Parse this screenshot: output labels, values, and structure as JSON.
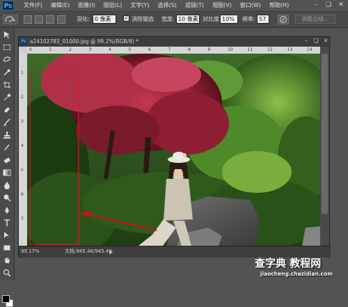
{
  "menubar": {
    "logo": "Ps",
    "items": [
      "文件(F)",
      "编辑(E)",
      "图像(I)",
      "图层(L)",
      "文字(Y)",
      "选择(S)",
      "滤镜(T)",
      "视图(V)",
      "窗口(W)",
      "帮助(H)"
    ]
  },
  "options": {
    "feather_label": "羽化:",
    "feather_value": "0 像素",
    "antialias_label": "消除锯齿",
    "width_label": "宽度:",
    "width_value": "10 像素",
    "contrast_label": "对比度:",
    "contrast_value": "10%",
    "frequency_label": "频率:",
    "frequency_value": "57",
    "refine_edge_label": "调整边缘..."
  },
  "document": {
    "title": "a24102783_01000.jpg @ 99.2%(RGB/8) *",
    "zoom": "99.17%",
    "doc_info": "文档:945.4K/945.4K",
    "ruler_top": [
      "0",
      "1",
      "2",
      "3",
      "4",
      "5",
      "6",
      "7",
      "8",
      "9",
      "10",
      "11",
      "12",
      "13",
      "14"
    ],
    "ruler_left": [
      "1",
      "2",
      "3",
      "4",
      "5",
      "6",
      "7"
    ]
  },
  "watermark": {
    "main": "查字典 教程网",
    "sub": "jiaocheng.chazidian.com"
  },
  "colors": {
    "foreground": "#000000",
    "background": "#ffffff",
    "selection_line": "#c8202a"
  }
}
